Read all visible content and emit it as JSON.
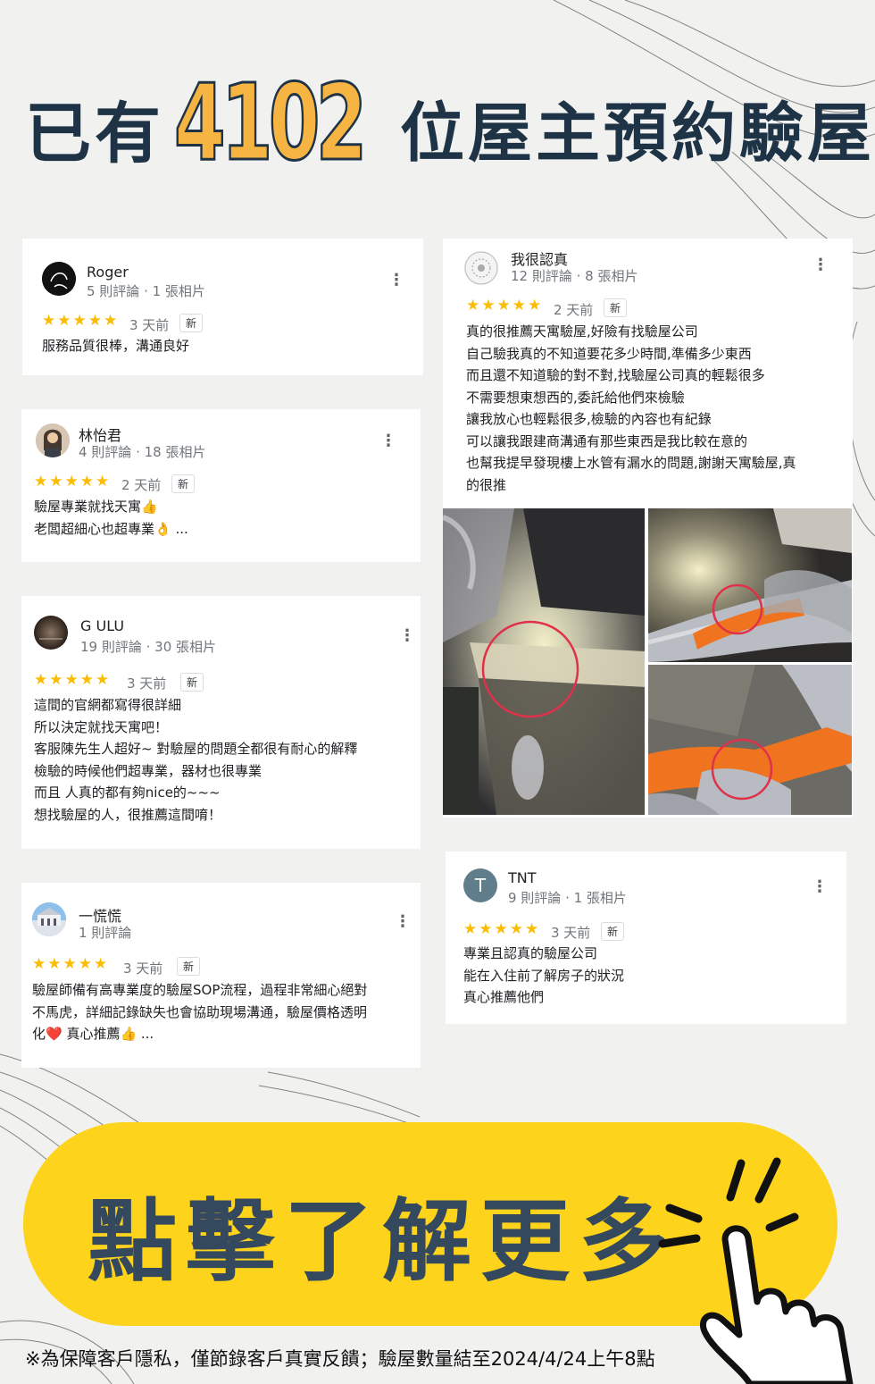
{
  "headline": {
    "prefix": "已有",
    "number": "4102",
    "suffix": "位屋主預約驗屋"
  },
  "reviews": [
    {
      "name": "Roger",
      "meta": "5 則評論 · 1 張相片",
      "rating": 5,
      "stars": "★★★★★",
      "ago": "3 天前",
      "badge": "新",
      "text": "服務品質很棒，溝通良好"
    },
    {
      "name": "林怡君",
      "meta": "4 則評論 · 18 張相片",
      "rating": 5,
      "stars": "★★★★★",
      "ago": "2 天前",
      "badge": "新",
      "text": "驗屋專業就找天寓👍\n老闆超細心也超專業👌 ..."
    },
    {
      "name": "G ULU",
      "meta": "19 則評論 · 30 張相片",
      "rating": 5,
      "stars": "★★★★★",
      "ago": "3 天前",
      "badge": "新",
      "text": "這間的官網都寫得很詳細\n所以決定就找天寓吧！\n客服陳先生人超好~ 對驗屋的問題全都很有耐心的解釋\n檢驗的時候他們超專業，器材也很專業\n而且  人真的都有夠nice的~~~\n想找驗屋的人，很推薦這間唷！"
    },
    {
      "name": "一慌慌",
      "meta": "1 則評論",
      "rating": 5,
      "stars": "★★★★★",
      "ago": "3 天前",
      "badge": "新",
      "text": "驗屋師備有高專業度的驗屋SOP流程，過程非常細心絕對\n不馬虎，詳細記錄缺失也會協助現場溝通，驗屋價格透明\n化❤️ 真心推薦👍 ..."
    },
    {
      "name": "我很認真",
      "meta": "12 則評論 · 8 張相片",
      "rating": 5,
      "stars": "★★★★★",
      "ago": "2 天前",
      "badge": "新",
      "text": "真的很推薦天寓驗屋,好險有找驗屋公司\n自己驗我真的不知道要花多少時間,準備多少東西\n而且還不知道驗的對不對,找驗屋公司真的輕鬆很多\n不需要想東想西的,委託給他們來檢驗\n讓我放心也輕鬆很多,檢驗的內容也有紀錄\n可以讓我跟建商溝通有那些東西是我比較在意的\n也幫我提早發現樓上水管有漏水的問題,謝謝天寓驗屋,真\n的很推"
    },
    {
      "name": "TNT",
      "initial": "T",
      "meta": "9 則評論 · 1 張相片",
      "rating": 5,
      "stars": "★★★★★",
      "ago": "3 天前",
      "badge": "新",
      "text": "專業且認真的驗屋公司\n能在入住前了解房子的狀況\n真心推薦他們"
    }
  ],
  "menu_glyph": "⋮",
  "cta": {
    "label": "點擊了解更多"
  },
  "footnote": "※為保障客戶隱私，僅節錄客戶真實反饋；驗屋數量結至2024/4/24上午8點",
  "colors": {
    "navy": "#1f3346",
    "number_fill": "#f6b443",
    "cta_yellow": "#fdd31b",
    "cta_text": "#34495e",
    "star": "#fbbc04",
    "pipe_orange": "#f0741f"
  }
}
